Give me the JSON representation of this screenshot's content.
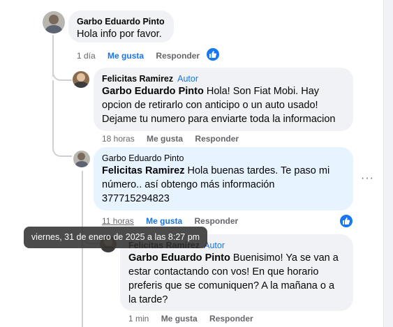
{
  "comments": [
    {
      "author": "Garbo Eduardo Pinto",
      "text": "Hola info por favor.",
      "time": "1 día",
      "like_label": "Me gusta",
      "reply_label": "Responder",
      "reaction": "like-icon"
    },
    {
      "author": "Felicitas Ramirez",
      "badge": "Autor",
      "mention": "Garbo Eduardo Pinto",
      "text_lines": [
        " Hola! Son Fiat Mobi. Hay",
        "opcion de retirarlo con anticipo o un auto usado!",
        "Dejame tu numero para enviarte toda la informacion"
      ],
      "time": "18 horas",
      "like_label": "Me gusta",
      "reply_label": "Responder"
    },
    {
      "author": "Garbo Eduardo Pinto",
      "mention": "Felicitas Ramirez",
      "text_lines": [
        " Hola buenas tardes. Te paso mi",
        "número.. así obtengo más información",
        "377715294823"
      ],
      "time": "11 horas",
      "like_label": "Me gusta",
      "reply_label": "Responder",
      "reaction": "like-icon",
      "more_label": "···"
    },
    {
      "author": "Felicitas Ramirez",
      "badge": "Autor",
      "mention": "Garbo Eduardo Pinto",
      "text_lines": [
        " Buenisimo! Ya se van a",
        "estar contactando con vos! En que horario",
        "preferis que se comuniquen? A la mañana o a",
        "la tarde?"
      ],
      "time": "1 min",
      "like_label": "Me gusta",
      "reply_label": "Responder"
    }
  ],
  "tooltip": "viernes, 31 de enero de 2025 a las 8:27 pm",
  "colors": {
    "accent": "#1b74e4",
    "bubble_grey": "#f0f2f5",
    "bubble_blue": "#e7f3ff"
  }
}
